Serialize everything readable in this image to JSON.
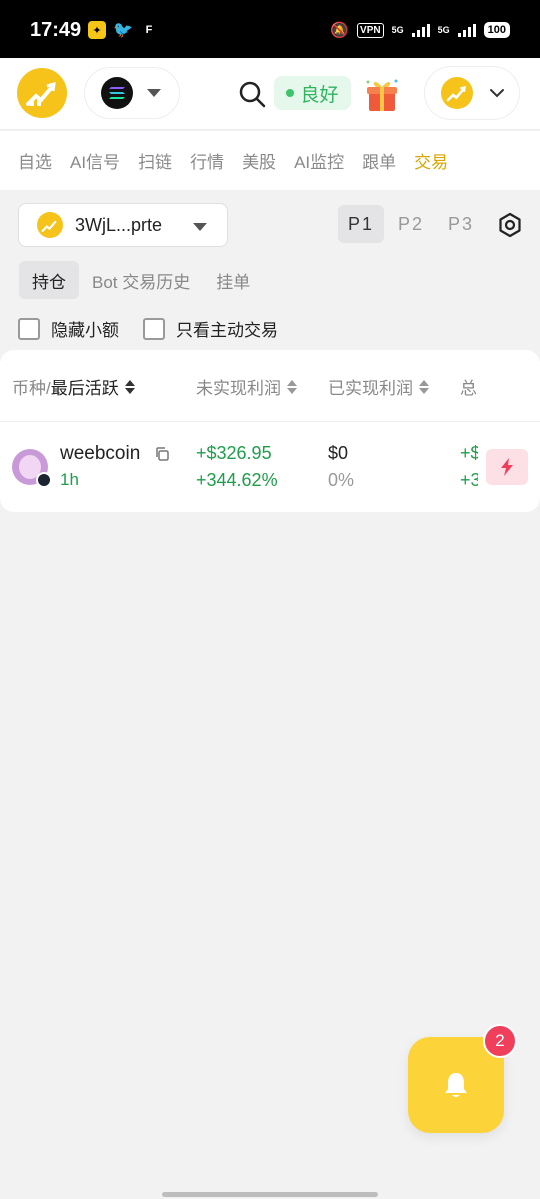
{
  "status_bar": {
    "time": "17:49",
    "vpn": "VPN",
    "network1": "5G",
    "network2": "5G",
    "battery": "100"
  },
  "header": {
    "connection_status": "良好"
  },
  "nav": {
    "tabs": [
      "自选",
      "AI信号",
      "扫链",
      "行情",
      "美股",
      "AI监控",
      "跟单",
      "交易"
    ],
    "active_index": 7
  },
  "toolbar": {
    "wallet_label": "3WjL...prte",
    "pages": [
      "P1",
      "P2",
      "P3"
    ],
    "active_page": 0
  },
  "subtabs": {
    "items": [
      "持仓",
      "Bot 交易历史",
      "挂单"
    ],
    "active_index": 0
  },
  "filters": {
    "hide_small": "隐藏小额",
    "only_active": "只看主动交易"
  },
  "table": {
    "headers": {
      "coin_prefix": "币种/",
      "coin_sort": "最后活跃",
      "unrealized": "未实现利润",
      "realized": "已实现利润",
      "total": "总"
    },
    "rows": [
      {
        "name": "weebcoin",
        "age": "1h",
        "unrealized_value": "+$326.95",
        "unrealized_pct": "+344.62%",
        "realized_value": "$0",
        "realized_pct": "0%",
        "total_value": "+$",
        "total_pct": "+3"
      }
    ]
  },
  "notifications": {
    "count": "2"
  },
  "colors": {
    "brand_yellow": "#f5c31a",
    "active_tab": "#d9a600",
    "profit_green": "#1e9e4a",
    "badge_red": "#ef3f5b"
  }
}
